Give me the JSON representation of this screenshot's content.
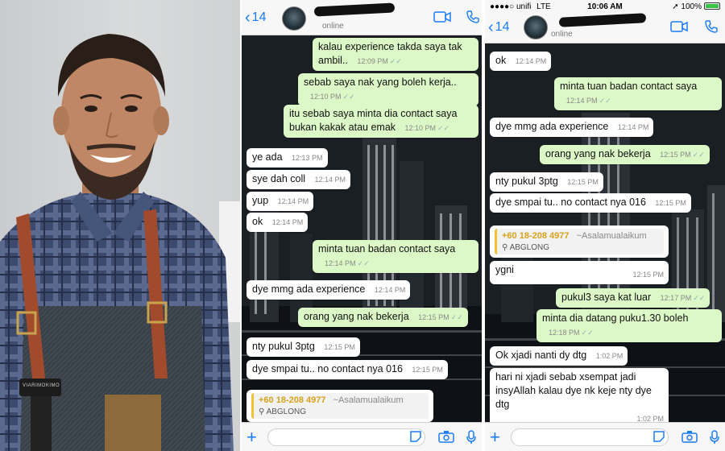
{
  "colors": {
    "ios_blue": "#1a7cf5",
    "outgoing_bubble": "#dcf8c6",
    "incoming_bubble": "#ffffff",
    "contact_card_accent": "#f2c230"
  },
  "left_photo": {
    "camera_logo_text": "VIARIMOKIMO"
  },
  "chat1": {
    "back_count": "14",
    "contact_status": "online",
    "messages": [
      {
        "dir": "out",
        "text": "kalau experience takda saya tak ambil..",
        "time": "12:09 PM"
      },
      {
        "dir": "out",
        "text": "sebab saya nak yang boleh kerja..",
        "time": "12:10 PM"
      },
      {
        "dir": "out",
        "text": "itu sebab saya minta dia contact saya bukan kakak atau emak",
        "time": "12:10 PM"
      },
      {
        "dir": "in",
        "text": "ye ada",
        "time": "12:13 PM"
      },
      {
        "dir": "in",
        "text": "sye dah coll",
        "time": "12:14 PM"
      },
      {
        "dir": "in",
        "text": "yup",
        "time": "12:14 PM"
      },
      {
        "dir": "in",
        "text": "ok",
        "time": "12:14 PM"
      },
      {
        "dir": "out",
        "text": "minta tuan badan contact saya",
        "time": "12:14 PM"
      },
      {
        "dir": "in",
        "text": "dye mmg ada experience",
        "time": "12:14 PM"
      },
      {
        "dir": "out",
        "text": "orang yang nak bekerja",
        "time": "12:15 PM"
      },
      {
        "dir": "in",
        "text": "nty pukul 3ptg",
        "time": "12:15 PM"
      },
      {
        "dir": "in",
        "text": "dye smpai tu.. no contact nya 016",
        "time": "12:15 PM"
      }
    ],
    "contact_card": {
      "phone": "+60 18-208 4977",
      "greeting": "~Asalamualaikum",
      "name": "ABGLONG"
    }
  },
  "chat2": {
    "status_carrier": "unifi",
    "status_network": "LTE",
    "status_time": "10:06 AM",
    "status_battery": "100%",
    "back_count": "14",
    "contact_status": "online",
    "messages": [
      {
        "dir": "in",
        "text": "ok",
        "time": "12:14 PM"
      },
      {
        "dir": "out",
        "text": "minta tuan badan contact saya",
        "time": "12:14 PM"
      },
      {
        "dir": "in",
        "text": "dye mmg ada experience",
        "time": "12:14 PM"
      },
      {
        "dir": "out",
        "text": "orang yang nak bekerja",
        "time": "12:15 PM"
      },
      {
        "dir": "in",
        "text": "nty pukul 3ptg",
        "time": "12:15 PM"
      },
      {
        "dir": "in",
        "text": "dye smpai tu.. no contact nya 016",
        "time": "12:15 PM"
      },
      {
        "dir": "in",
        "text": "ygni",
        "time": "12:15 PM"
      },
      {
        "dir": "out",
        "text": "pukul3 saya kat luar",
        "time": "12:17 PM"
      },
      {
        "dir": "out",
        "text": "minta dia datang puku1.30 boleh",
        "time": "12:18 PM"
      },
      {
        "dir": "in",
        "text": "Ok xjadi nanti dy dtg",
        "time": "1:02 PM"
      },
      {
        "dir": "in",
        "text": "hari ni xjadi sebab xsempat jadi insyAllah kalau dye nk keje nty dye dtg",
        "time": "1:02 PM"
      }
    ],
    "contact_card": {
      "phone": "+60 18-208 4977",
      "greeting": "~Asalamualaikum",
      "name": "ABGLONG"
    }
  }
}
